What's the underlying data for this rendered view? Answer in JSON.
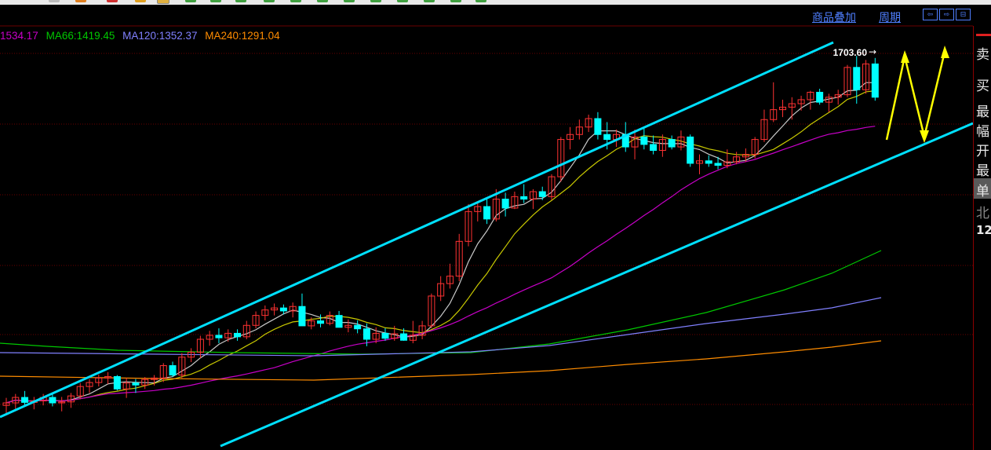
{
  "header": {
    "overlay_label": "商品叠加",
    "period_label": "周期",
    "nav_icons": [
      "arrow-left-icon",
      "arrow-right-icon",
      "grid-icon"
    ]
  },
  "ma_legend": [
    {
      "text": "1534.17",
      "color": "#c800c8"
    },
    {
      "text": "MA66:1419.45",
      "color": "#00c800"
    },
    {
      "text": "MA120:1352.37",
      "color": "#8080ff"
    },
    {
      "text": "MA240:1291.04",
      "color": "#ff8c00"
    }
  ],
  "right_panel": {
    "items": [
      "卖",
      "买",
      "最",
      "幅",
      "开",
      "最",
      "单",
      "北",
      "12"
    ]
  },
  "chart_data": {
    "type": "candlestick",
    "title": "",
    "price_annotation": "1703.60",
    "colors": {
      "up": "#ff3232",
      "down": "#00ffff",
      "ma_short": "#c8c8c8",
      "ma_mid": "#c8c800",
      "ma_a": "#c800c8",
      "ma_66": "#00c800",
      "ma_120": "#8080ff",
      "ma_240": "#ff8c00",
      "channel": "#00e0ff",
      "forecast": "#ffff00",
      "grid": "#6a0000"
    },
    "candles": [
      {
        "o": 1005,
        "h": 1020,
        "l": 988,
        "c": 1010
      },
      {
        "o": 1010,
        "h": 1028,
        "l": 998,
        "c": 1021
      },
      {
        "o": 1021,
        "h": 1034,
        "l": 1006,
        "c": 1011
      },
      {
        "o": 1011,
        "h": 1022,
        "l": 997,
        "c": 1014
      },
      {
        "o": 1014,
        "h": 1028,
        "l": 1005,
        "c": 1021
      },
      {
        "o": 1021,
        "h": 1029,
        "l": 1003,
        "c": 1010
      },
      {
        "o": 1010,
        "h": 1022,
        "l": 993,
        "c": 1012
      },
      {
        "o": 1012,
        "h": 1030,
        "l": 1000,
        "c": 1024
      },
      {
        "o": 1024,
        "h": 1050,
        "l": 1018,
        "c": 1043
      },
      {
        "o": 1043,
        "h": 1058,
        "l": 1030,
        "c": 1051
      },
      {
        "o": 1051,
        "h": 1067,
        "l": 1043,
        "c": 1060
      },
      {
        "o": 1060,
        "h": 1072,
        "l": 1048,
        "c": 1063
      },
      {
        "o": 1063,
        "h": 1066,
        "l": 1035,
        "c": 1038
      },
      {
        "o": 1038,
        "h": 1060,
        "l": 1020,
        "c": 1050
      },
      {
        "o": 1050,
        "h": 1058,
        "l": 1030,
        "c": 1046
      },
      {
        "o": 1046,
        "h": 1062,
        "l": 1038,
        "c": 1057
      },
      {
        "o": 1057,
        "h": 1066,
        "l": 1045,
        "c": 1060
      },
      {
        "o": 1060,
        "h": 1090,
        "l": 1052,
        "c": 1085
      },
      {
        "o": 1085,
        "h": 1093,
        "l": 1062,
        "c": 1066
      },
      {
        "o": 1066,
        "h": 1110,
        "l": 1060,
        "c": 1102
      },
      {
        "o": 1102,
        "h": 1120,
        "l": 1092,
        "c": 1112
      },
      {
        "o": 1112,
        "h": 1145,
        "l": 1100,
        "c": 1138
      },
      {
        "o": 1138,
        "h": 1155,
        "l": 1125,
        "c": 1146
      },
      {
        "o": 1146,
        "h": 1160,
        "l": 1130,
        "c": 1141
      },
      {
        "o": 1141,
        "h": 1158,
        "l": 1133,
        "c": 1150
      },
      {
        "o": 1150,
        "h": 1158,
        "l": 1135,
        "c": 1143
      },
      {
        "o": 1143,
        "h": 1175,
        "l": 1138,
        "c": 1166
      },
      {
        "o": 1166,
        "h": 1194,
        "l": 1160,
        "c": 1186
      },
      {
        "o": 1186,
        "h": 1206,
        "l": 1176,
        "c": 1197
      },
      {
        "o": 1197,
        "h": 1210,
        "l": 1186,
        "c": 1201
      },
      {
        "o": 1201,
        "h": 1208,
        "l": 1188,
        "c": 1195
      },
      {
        "o": 1195,
        "h": 1212,
        "l": 1182,
        "c": 1204
      },
      {
        "o": 1204,
        "h": 1230,
        "l": 1165,
        "c": 1165
      },
      {
        "o": 1165,
        "h": 1182,
        "l": 1158,
        "c": 1175
      },
      {
        "o": 1175,
        "h": 1188,
        "l": 1162,
        "c": 1170
      },
      {
        "o": 1170,
        "h": 1194,
        "l": 1166,
        "c": 1186
      },
      {
        "o": 1186,
        "h": 1195,
        "l": 1162,
        "c": 1162
      },
      {
        "o": 1162,
        "h": 1178,
        "l": 1152,
        "c": 1166
      },
      {
        "o": 1166,
        "h": 1176,
        "l": 1150,
        "c": 1159
      },
      {
        "o": 1159,
        "h": 1170,
        "l": 1124,
        "c": 1138
      },
      {
        "o": 1138,
        "h": 1162,
        "l": 1130,
        "c": 1150
      },
      {
        "o": 1150,
        "h": 1160,
        "l": 1135,
        "c": 1140
      },
      {
        "o": 1140,
        "h": 1165,
        "l": 1135,
        "c": 1149
      },
      {
        "o": 1149,
        "h": 1160,
        "l": 1135,
        "c": 1136
      },
      {
        "o": 1136,
        "h": 1175,
        "l": 1130,
        "c": 1146
      },
      {
        "o": 1146,
        "h": 1175,
        "l": 1138,
        "c": 1165
      },
      {
        "o": 1165,
        "h": 1230,
        "l": 1160,
        "c": 1225
      },
      {
        "o": 1225,
        "h": 1265,
        "l": 1215,
        "c": 1250
      },
      {
        "o": 1250,
        "h": 1290,
        "l": 1240,
        "c": 1265
      },
      {
        "o": 1265,
        "h": 1350,
        "l": 1255,
        "c": 1335
      },
      {
        "o": 1335,
        "h": 1410,
        "l": 1325,
        "c": 1395
      },
      {
        "o": 1395,
        "h": 1415,
        "l": 1375,
        "c": 1405
      },
      {
        "o": 1405,
        "h": 1420,
        "l": 1370,
        "c": 1380
      },
      {
        "o": 1380,
        "h": 1440,
        "l": 1375,
        "c": 1420
      },
      {
        "o": 1420,
        "h": 1433,
        "l": 1385,
        "c": 1402
      },
      {
        "o": 1402,
        "h": 1435,
        "l": 1400,
        "c": 1425
      },
      {
        "o": 1425,
        "h": 1450,
        "l": 1412,
        "c": 1420
      },
      {
        "o": 1420,
        "h": 1440,
        "l": 1400,
        "c": 1435
      },
      {
        "o": 1435,
        "h": 1445,
        "l": 1418,
        "c": 1425
      },
      {
        "o": 1425,
        "h": 1470,
        "l": 1418,
        "c": 1465
      },
      {
        "o": 1465,
        "h": 1545,
        "l": 1455,
        "c": 1540
      },
      {
        "o": 1540,
        "h": 1565,
        "l": 1520,
        "c": 1550
      },
      {
        "o": 1550,
        "h": 1580,
        "l": 1540,
        "c": 1565
      },
      {
        "o": 1565,
        "h": 1590,
        "l": 1555,
        "c": 1582
      },
      {
        "o": 1582,
        "h": 1595,
        "l": 1540,
        "c": 1550
      },
      {
        "o": 1550,
        "h": 1575,
        "l": 1520,
        "c": 1540
      },
      {
        "o": 1540,
        "h": 1560,
        "l": 1525,
        "c": 1550
      },
      {
        "o": 1550,
        "h": 1575,
        "l": 1515,
        "c": 1525
      },
      {
        "o": 1525,
        "h": 1560,
        "l": 1500,
        "c": 1545
      },
      {
        "o": 1545,
        "h": 1565,
        "l": 1520,
        "c": 1530
      },
      {
        "o": 1530,
        "h": 1548,
        "l": 1510,
        "c": 1518
      },
      {
        "o": 1518,
        "h": 1550,
        "l": 1505,
        "c": 1540
      },
      {
        "o": 1540,
        "h": 1548,
        "l": 1520,
        "c": 1525
      },
      {
        "o": 1525,
        "h": 1558,
        "l": 1518,
        "c": 1545
      },
      {
        "o": 1545,
        "h": 1550,
        "l": 1485,
        "c": 1492
      },
      {
        "o": 1492,
        "h": 1510,
        "l": 1470,
        "c": 1497
      },
      {
        "o": 1497,
        "h": 1508,
        "l": 1485,
        "c": 1492
      },
      {
        "o": 1492,
        "h": 1505,
        "l": 1480,
        "c": 1488
      },
      {
        "o": 1488,
        "h": 1520,
        "l": 1482,
        "c": 1495
      },
      {
        "o": 1495,
        "h": 1515,
        "l": 1490,
        "c": 1505
      },
      {
        "o": 1505,
        "h": 1522,
        "l": 1495,
        "c": 1510
      },
      {
        "o": 1510,
        "h": 1545,
        "l": 1502,
        "c": 1540
      },
      {
        "o": 1540,
        "h": 1600,
        "l": 1535,
        "c": 1580
      },
      {
        "o": 1580,
        "h": 1655,
        "l": 1575,
        "c": 1600
      },
      {
        "o": 1600,
        "h": 1620,
        "l": 1585,
        "c": 1605
      },
      {
        "o": 1605,
        "h": 1625,
        "l": 1580,
        "c": 1612
      },
      {
        "o": 1612,
        "h": 1628,
        "l": 1598,
        "c": 1620
      },
      {
        "o": 1620,
        "h": 1638,
        "l": 1600,
        "c": 1635
      },
      {
        "o": 1635,
        "h": 1642,
        "l": 1610,
        "c": 1615
      },
      {
        "o": 1615,
        "h": 1632,
        "l": 1595,
        "c": 1625
      },
      {
        "o": 1625,
        "h": 1640,
        "l": 1610,
        "c": 1630
      },
      {
        "o": 1630,
        "h": 1690,
        "l": 1625,
        "c": 1685
      },
      {
        "o": 1685,
        "h": 1708,
        "l": 1612,
        "c": 1640
      },
      {
        "o": 1640,
        "h": 1700,
        "l": 1632,
        "c": 1692
      },
      {
        "o": 1692,
        "h": 1704,
        "l": 1618,
        "c": 1625
      }
    ]
  }
}
